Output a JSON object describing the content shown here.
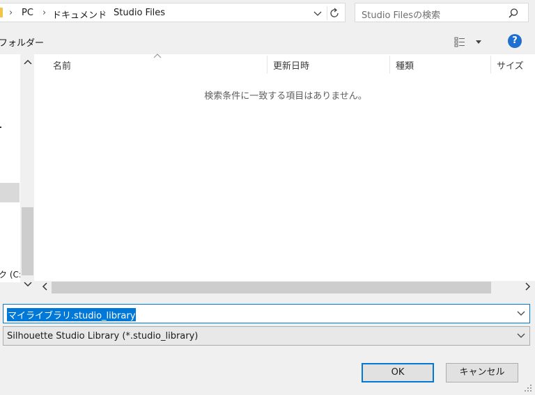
{
  "address": {
    "crumbs": [
      "PC",
      "ドキュメント",
      "Studio Files"
    ],
    "separator": "›"
  },
  "search": {
    "placeholder": "Studio Filesの検索"
  },
  "toolbar": {
    "new_folder": "フォルダー",
    "help": "?"
  },
  "columns": [
    "名前",
    "更新日時",
    "種類",
    "サイズ"
  ],
  "list": {
    "empty_message": "検索条件に一致する項目はありません。"
  },
  "nav": {
    "drive_label": "ク (C:"
  },
  "filename": {
    "value": "マイライブラリ.studio_library"
  },
  "filetype": {
    "value": "Silhouette Studio Library (*.studio_library)"
  },
  "buttons": {
    "ok": "OK",
    "cancel": "キャンセル"
  },
  "colors": {
    "accent": "#0078d7",
    "help": "#1e6fd0",
    "selection": "#0078d7"
  }
}
